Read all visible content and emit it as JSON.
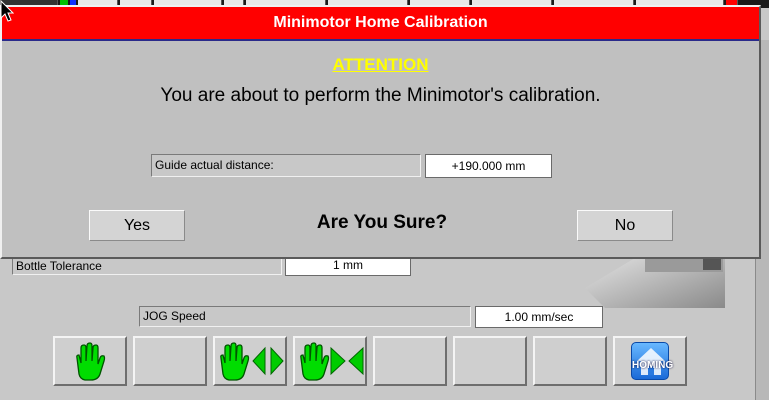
{
  "dialog": {
    "title": "Minimotor Home Calibration",
    "attention": "ATTENTION",
    "message": "You are about to perform the Minimotor's calibration.",
    "distance_label": "Guide actual distance:",
    "distance_value": "+190.000 mm",
    "question": "Are You Sure?",
    "yes_label": "Yes",
    "no_label": "No"
  },
  "background": {
    "bottle_tolerance_label": "Bottle Tolerance",
    "bottle_tolerance_value": "1 mm",
    "jog_speed_label": "JOG Speed",
    "jog_speed_value": "1.00 mm/sec"
  },
  "toolbar": {
    "buttons": [
      "hand-stop",
      "empty",
      "hand-jog-both",
      "hand-jog-forward",
      "empty",
      "empty",
      "empty",
      "homing"
    ],
    "homing_label": "HOMING"
  },
  "colors": {
    "title_bar": "#ff0000",
    "attention_text": "#ffff00",
    "hand_green": "#00dd00"
  }
}
